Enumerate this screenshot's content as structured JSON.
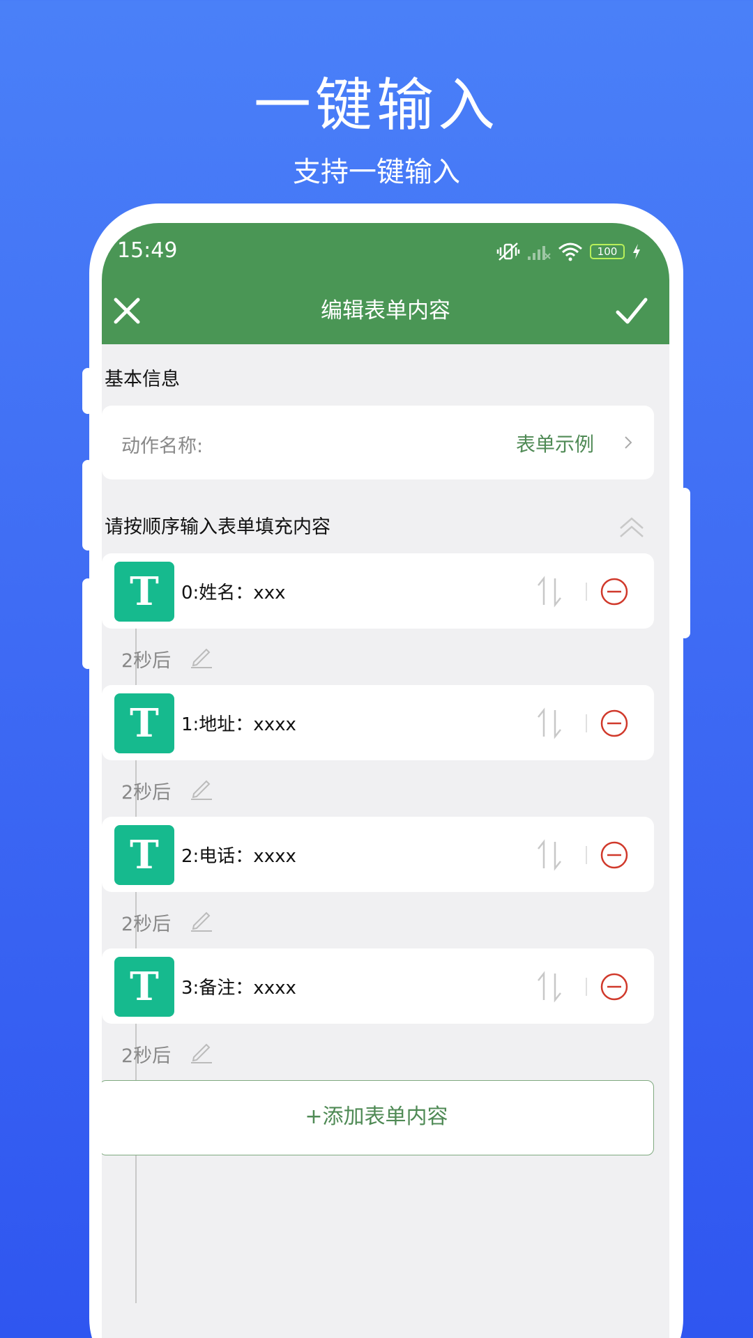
{
  "promo": {
    "title": "一键输入",
    "subtitle": "支持一键输入"
  },
  "status_bar": {
    "time": "15:49",
    "battery": "100"
  },
  "app_bar": {
    "title": "编辑表单内容",
    "close_icon": "close-icon",
    "confirm_icon": "check-icon"
  },
  "basic_info": {
    "section_label": "基本信息",
    "action_name_label": "动作名称:",
    "action_name_value": "表单示例"
  },
  "form_section": {
    "label": "请按顺序输入表单填充内容",
    "items": [
      {
        "badge": "T",
        "text": "0:姓名：xxx",
        "delay": "2秒后"
      },
      {
        "badge": "T",
        "text": "1:地址：xxxx",
        "delay": "2秒后"
      },
      {
        "badge": "T",
        "text": "2:电话：xxxx",
        "delay": "2秒后"
      },
      {
        "badge": "T",
        "text": "3:备注：xxxx",
        "delay": "2秒后"
      }
    ],
    "add_button": "+添加表单内容"
  },
  "colors": {
    "background": "#3f6cf4",
    "app_bar": "#4a9655",
    "badge": "#16ba8e",
    "accent_text": "#4f8a55",
    "remove": "#d0392b"
  }
}
